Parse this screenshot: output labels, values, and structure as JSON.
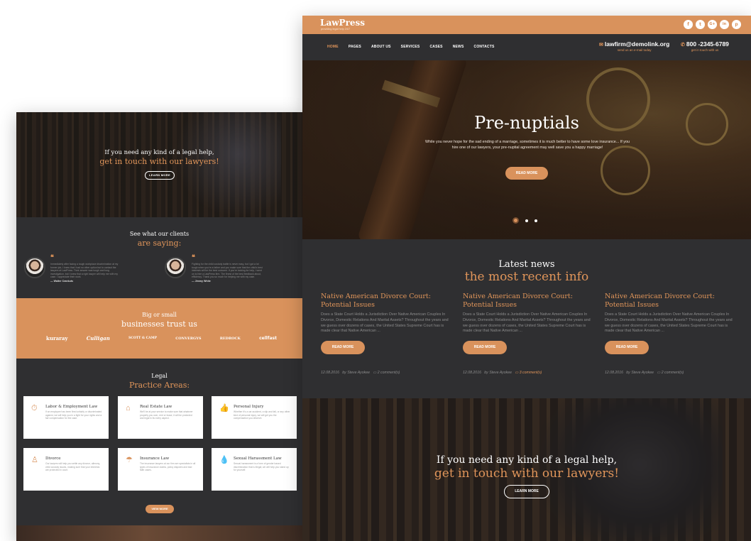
{
  "left_page": {
    "hero": {
      "line1": "If you need any kind of a legal help,",
      "line2": "get in touch with our lawyers!",
      "button": "LEARN MORE"
    },
    "testimonials": {
      "heading1": "See what our clients",
      "heading2": "are saying:",
      "items": [
        {
          "quote": "Immediately after facing a tough workplace discrimination at my former job, I knew that I had no other option but to contact the lawyers at LawPress. Their answer was tough and long investigation, but I knew that a right lawyer will help me with my case. I appreciate their work.",
          "name": "— Walter Crankuts"
        },
        {
          "quote": "Fighting for the child custody battle is never easy, but I got a lot tough when you're a father and you make sure that the child's best interests will be the best outcome. If you're looking for help, I went on to hire a LawPress firm. The finest of the best feedback about, efficiency. Thank you so much for helping me with my case.",
          "name": "— Jimmy White"
        }
      ]
    },
    "clients": {
      "heading1": "Big or small",
      "heading2": "businesses trust us",
      "logos": [
        "kuraray",
        "Culligan",
        "SCOTT & CAMP",
        "CONVERGYS",
        "REDROCK",
        "cellfast"
      ]
    },
    "practice": {
      "heading1": "Legal",
      "heading2": "Practice Areas:",
      "cards": [
        {
          "icon": "stopwatch-icon",
          "glyph": "⏱",
          "title": "Labor & Employment Law",
          "desc": "If an employee has been fired unfairly or discriminated against, we will help you in a fight for your rights and a fair compensation for the case."
        },
        {
          "icon": "house-icon",
          "glyph": "⌂",
          "title": "Real Estate Law",
          "desc": "We'll be at your service to make sure that whatever property you own, rent or lease, it will be protected and legal in its every aspect."
        },
        {
          "icon": "thumbs-up-icon",
          "glyph": "👍",
          "title": "Personal Injury",
          "desc": "Whether it's a car accident, a slip and fall, or any other kind of personal injury, we will get you the compensation you deserve."
        },
        {
          "icon": "person-icon",
          "glyph": "♙",
          "title": "Divorce",
          "desc": "Our lawyers will help you settle any divorce, alimony, child custody issues, making sure that your interests are protected in court."
        },
        {
          "icon": "umbrella-icon",
          "glyph": "☂",
          "title": "Insurance Law",
          "desc": "The insurance lawyers at our firm are specialists in all types of insurance claims, policy disputes and bad faith cases."
        },
        {
          "icon": "drop-icon",
          "glyph": "💧",
          "title": "Sexual Harassment Law",
          "desc": "Sexual harassment is a form of gender based discrimination that is illegal; we will help you stand up for yourself."
        }
      ],
      "button": "VIEW MORE"
    }
  },
  "right_page": {
    "brand": "LawPress",
    "tagline": "providing legal help 24/7",
    "social": [
      {
        "icon": "facebook-icon",
        "glyph": "f"
      },
      {
        "icon": "twitter-icon",
        "glyph": "t"
      },
      {
        "icon": "google-plus-icon",
        "glyph": "G+"
      },
      {
        "icon": "linkedin-icon",
        "glyph": "in"
      },
      {
        "icon": "pinterest-icon",
        "glyph": "p"
      }
    ],
    "nav": [
      "HOME",
      "PAGES",
      "ABOUT US",
      "SERVICES",
      "CASES",
      "NEWS",
      "CONTACTS"
    ],
    "email": {
      "value": "lawfirm@demolink.org",
      "caption": "send us an e-mail today"
    },
    "phone": {
      "value": "800 -2345-6789",
      "caption": "get in touch with us"
    },
    "hero": {
      "title": "Pre-nuptials",
      "text": "While you never hope for the sad ending of a marriage, sometimes it is much better to have some love insurance... If you hire one of our lawyers, your pre-nuptial agreement may well save you a happy marriage!",
      "button": "READ MORE",
      "slides_total": 3,
      "active_slide": 1
    },
    "news": {
      "heading1": "Latest news",
      "heading2": "the most recent info",
      "posts": [
        {
          "title": "Native American Divorce Court: Potential Issues",
          "excerpt": "Does a State Court Holds a Jurisdiction Over Native American Couples In Divorce, Domestic Relations And Marital Assets? Throughout the years and we guess over dozens of cases, the United States Supreme Court has is made clear that Native American ...",
          "button": "READ MORE",
          "date": "12.08.2016",
          "author": "by Steve Ayokee",
          "comments": "2 comment(s)"
        },
        {
          "title": "Native American Divorce Court: Potential Issues",
          "excerpt": "Does a State Court Holds a Jurisdiction Over Native American Couples In Divorce, Domestic Relations And Marital Assets? Throughout the years and we guess over dozens of cases, the United States Supreme Court has is made clear that Native American ...",
          "button": "READ MORE",
          "date": "12.08.2016",
          "author": "by Steve Ayokee",
          "comments": "3 comment(s)"
        },
        {
          "title": "Native American Divorce Court: Potential Issues",
          "excerpt": "Does a State Court Holds a Jurisdiction Over Native American Couples In Divorce, Domestic Relations And Marital Assets? Throughout the years and we guess over dozens of cases, the United States Supreme Court has is made clear that Native American ...",
          "button": "READ MORE",
          "date": "12.08.2016",
          "author": "by Steve Ayokee",
          "comments": "2 comment(s)"
        }
      ]
    },
    "cta": {
      "line1": "If you need any kind of a legal help,",
      "line2": "get in touch with our lawyers!",
      "button": "LEARN MORE"
    }
  },
  "colors": {
    "accent": "#d9925c",
    "accent_text": "#e0955a",
    "dark": "#2f2f31"
  }
}
